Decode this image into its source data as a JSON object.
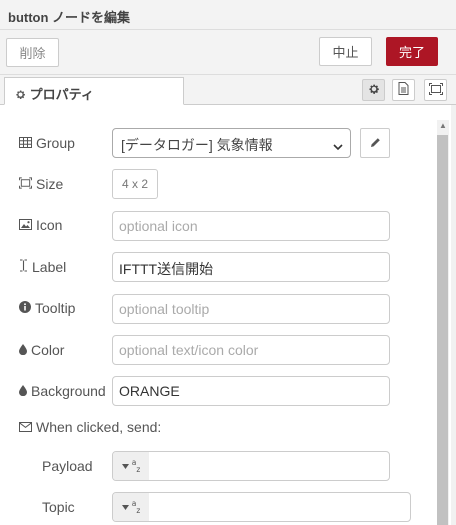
{
  "header": {
    "title": "button ノードを編集"
  },
  "toolbar": {
    "delete_label": "削除",
    "cancel_label": "中止",
    "done_label": "完了"
  },
  "tabs": {
    "properties_label": "プロパティ"
  },
  "form": {
    "group": {
      "label": "Group",
      "value": "[データロガー] 気象情報"
    },
    "size": {
      "label": "Size",
      "value": "4 x 2"
    },
    "icon": {
      "label": "Icon",
      "placeholder": "optional icon"
    },
    "text_label": {
      "label": "Label",
      "value": "IFTTT送信開始"
    },
    "tooltip": {
      "label": "Tooltip",
      "placeholder": "optional tooltip"
    },
    "color": {
      "label": "Color",
      "placeholder": "optional text/icon color"
    },
    "background": {
      "label": "Background",
      "value": "ORANGE"
    },
    "when_clicked": {
      "label": "When clicked, send:"
    },
    "payload": {
      "label": "Payload",
      "value": ""
    },
    "topic": {
      "label": "Topic",
      "value": ""
    }
  },
  "colors": {
    "primary_button": "#ad1625",
    "text": "#555555",
    "border": "#cccccc"
  }
}
